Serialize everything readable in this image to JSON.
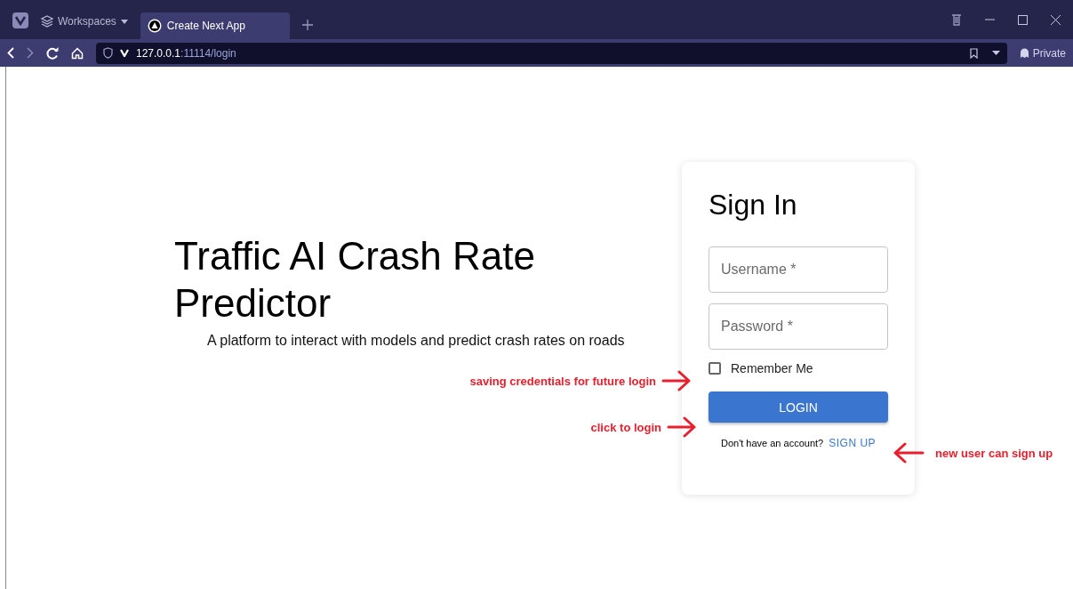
{
  "browser": {
    "workspaces_label": "Workspaces",
    "tabs": [
      {
        "title": "Create Next App",
        "selected": true
      }
    ],
    "url_host": "127.0.0.1",
    "url_rest": ":11114/login",
    "private_label": "Private"
  },
  "hero": {
    "title": "Traffic AI Crash Rate Predictor",
    "subtitle": "A platform to interact with models and predict crash rates on roads"
  },
  "form": {
    "title": "Sign In",
    "fields": [
      {
        "placeholder": "Username *"
      },
      {
        "placeholder": "Password *"
      }
    ],
    "remember": {
      "label": "Remember Me",
      "checked": false
    },
    "login_button": "LOGIN",
    "signup_prompt": "Don't have an account?",
    "signup_link": "SIGN UP"
  },
  "annotations": [
    {
      "text": "saving credentials for future login",
      "kind": "left"
    },
    {
      "text": "click to login",
      "kind": "left"
    },
    {
      "text": "new user can sign up",
      "kind": "right"
    }
  ]
}
